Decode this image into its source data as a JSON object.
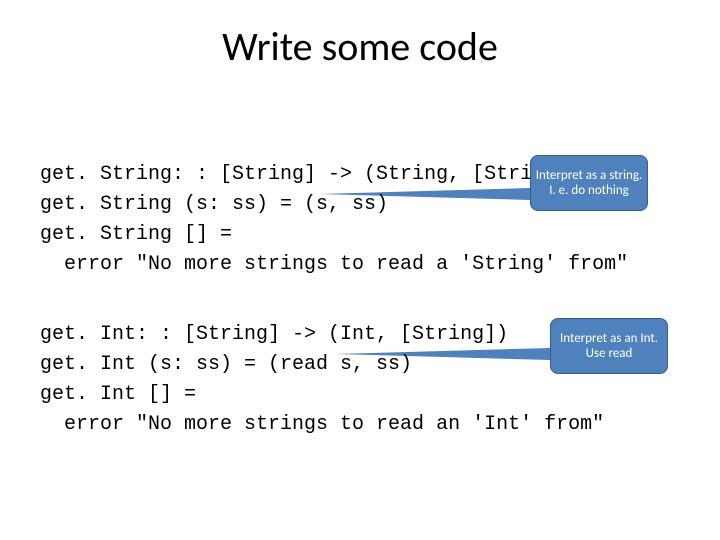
{
  "title": "Write some code",
  "code1": {
    "l1": "get. String: : [String] -> (String, [String])",
    "l2": "get. String (s: ss) = (s, ss)",
    "l3": "get. String [] =",
    "l4": "  error \"No more strings to read a 'String' from\""
  },
  "code2": {
    "l1": "get. Int: : [String] -> (Int, [String])",
    "l2": "get. Int (s: ss) = (read s, ss)",
    "l3": "get. Int [] =",
    "l4": "  error \"No more strings to read an 'Int' from\""
  },
  "callouts": {
    "c1": "Interpret as a string.  I. e. do nothing",
    "c2": "Interpret as an Int. Use read"
  }
}
